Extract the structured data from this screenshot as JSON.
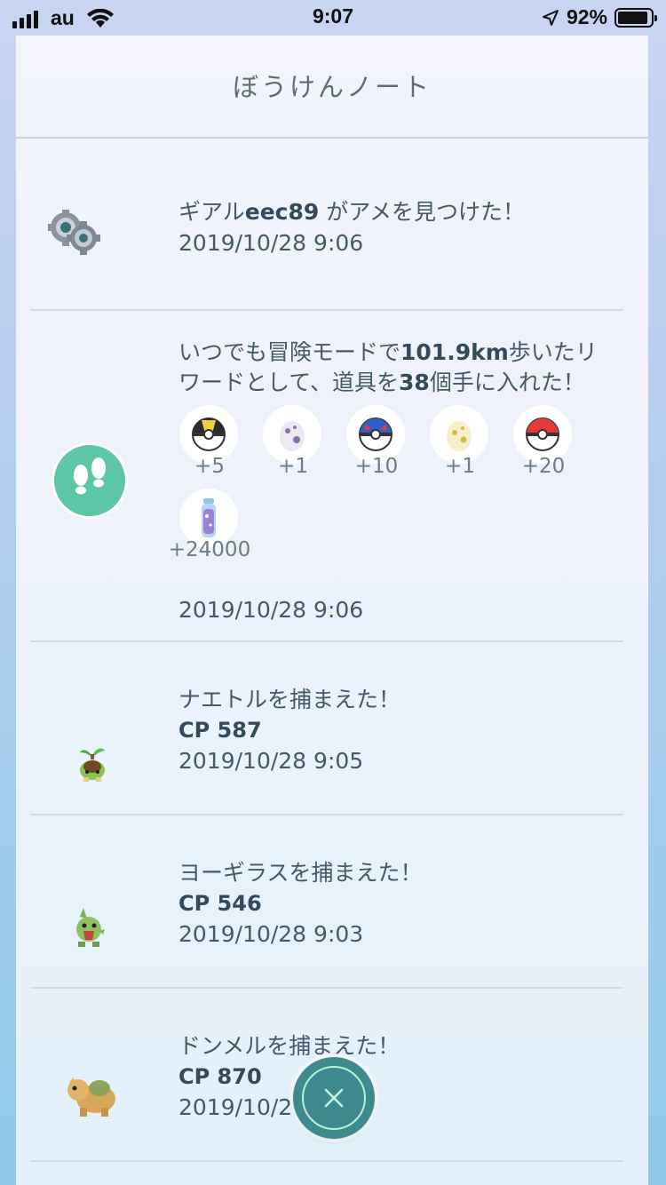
{
  "status_bar": {
    "carrier": "au",
    "time": "9:07",
    "battery": "92%"
  },
  "journal": {
    "title": "ぼうけんノート",
    "entries": [
      {
        "icon": "klink-icon",
        "message_pre": "ギアル",
        "message_bold": "eec89",
        "message_post": " がアメを見つけた！",
        "date": "2019/10/28 9:06"
      },
      {
        "icon": "footprints-icon",
        "message_line1_pre": "いつでも冒険モードで",
        "message_line1_bold": "101.9km",
        "message_line1_post": "歩いたリ",
        "message_line2_pre": "ワードとして、道具を",
        "message_line2_bold": "38",
        "message_line2_post": "個手に入れた！",
        "items": [
          {
            "icon": "ultra-ball-icon",
            "count": "+5"
          },
          {
            "icon": "egg-10km-icon",
            "count": "+1"
          },
          {
            "icon": "great-ball-icon",
            "count": "+10"
          },
          {
            "icon": "egg-2km-icon",
            "count": "+1"
          },
          {
            "icon": "poke-ball-icon",
            "count": "+20"
          },
          {
            "icon": "stardust-icon",
            "count": "+24000"
          }
        ],
        "date": "2019/10/28 9:06"
      },
      {
        "icon": "turtwig-icon",
        "message": "ナエトルを捕まえた！",
        "cp": "CP 587",
        "date": "2019/10/28 9:05"
      },
      {
        "icon": "larvitar-icon",
        "message": "ヨーギラスを捕まえた！",
        "cp": "CP 546",
        "date": "2019/10/28 9:03"
      },
      {
        "icon": "numel-icon",
        "message": "ドンメルを捕まえた！",
        "cp": "CP 870",
        "date": "2019/10/2"
      }
    ]
  },
  "colors": {
    "accent": "#5cc6a6",
    "close_button": "#3f8a8e"
  }
}
